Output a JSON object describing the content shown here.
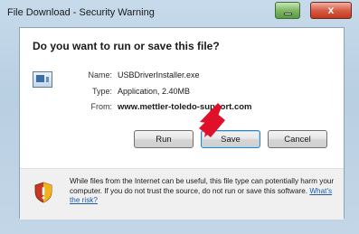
{
  "window": {
    "title": "File Download - Security Warning",
    "close_glyph": "x"
  },
  "dialog": {
    "question": "Do you want to run or save this file?",
    "file": {
      "name_label": "Name:",
      "name_value": "USBDriverInstaller.exe",
      "type_label": "Type:",
      "type_value": "Application, 2.40MB",
      "from_label": "From:",
      "from_value": "www.mettler-toledo-support.com"
    },
    "buttons": {
      "run": "Run",
      "save": "Save",
      "cancel": "Cancel"
    },
    "warning": {
      "text": "While files from the Internet can be useful, this file type can potentially harm your computer. If you do not trust the source, do not run or save this software. ",
      "link": "What's the risk?"
    }
  },
  "colors": {
    "annotation_arrow": "#e0102a",
    "shield_red": "#c63a24",
    "shield_gold": "#f2b21a"
  },
  "icons": {
    "file": "application-file-icon",
    "warning": "security-shield-icon",
    "annotation": "red-pointer-arrow"
  }
}
